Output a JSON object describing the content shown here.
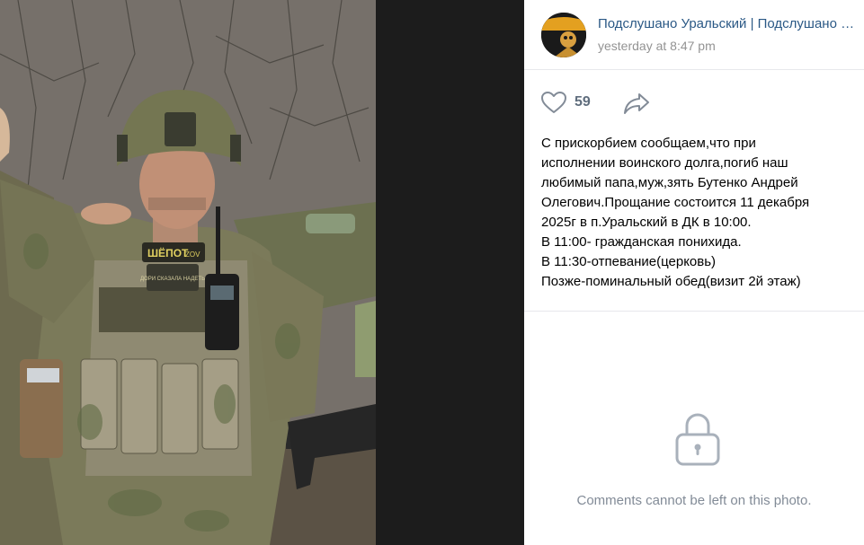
{
  "post": {
    "author": "Подслушано Уральский | Подслушано в посёлке Уральский",
    "date": "yesterday at 8:47 pm",
    "likes": "59",
    "text_lines": [
      "С прискорбием сообщаем,что при",
      "исполнении воинского долга,погиб наш",
      "любимый папа,муж,зять Бутенко Андрей",
      "Олегович.Прощание состоится 11 декабря",
      "2025г в п.Уральский в ДК в 10:00.",
      "В 11:00- гражданская понихида.",
      "В 11:30-отпевание(церковь)",
      "Позже-поминальный обед(визит 2й этаж)"
    ]
  },
  "photo": {
    "patch_text_1": "ШЁПОТ",
    "patch_text_2": "ZOV",
    "patch_text_3": "ДОРИ СКАЗАЛА НАДЕТЬ"
  },
  "comments": {
    "disabled_message": "Comments cannot be left on this photo."
  },
  "icons": {
    "like": "heart-icon",
    "share": "share-icon",
    "lock": "lock-icon"
  },
  "colors": {
    "link": "#2a5885",
    "muted": "#939393",
    "icon": "#828b97"
  }
}
